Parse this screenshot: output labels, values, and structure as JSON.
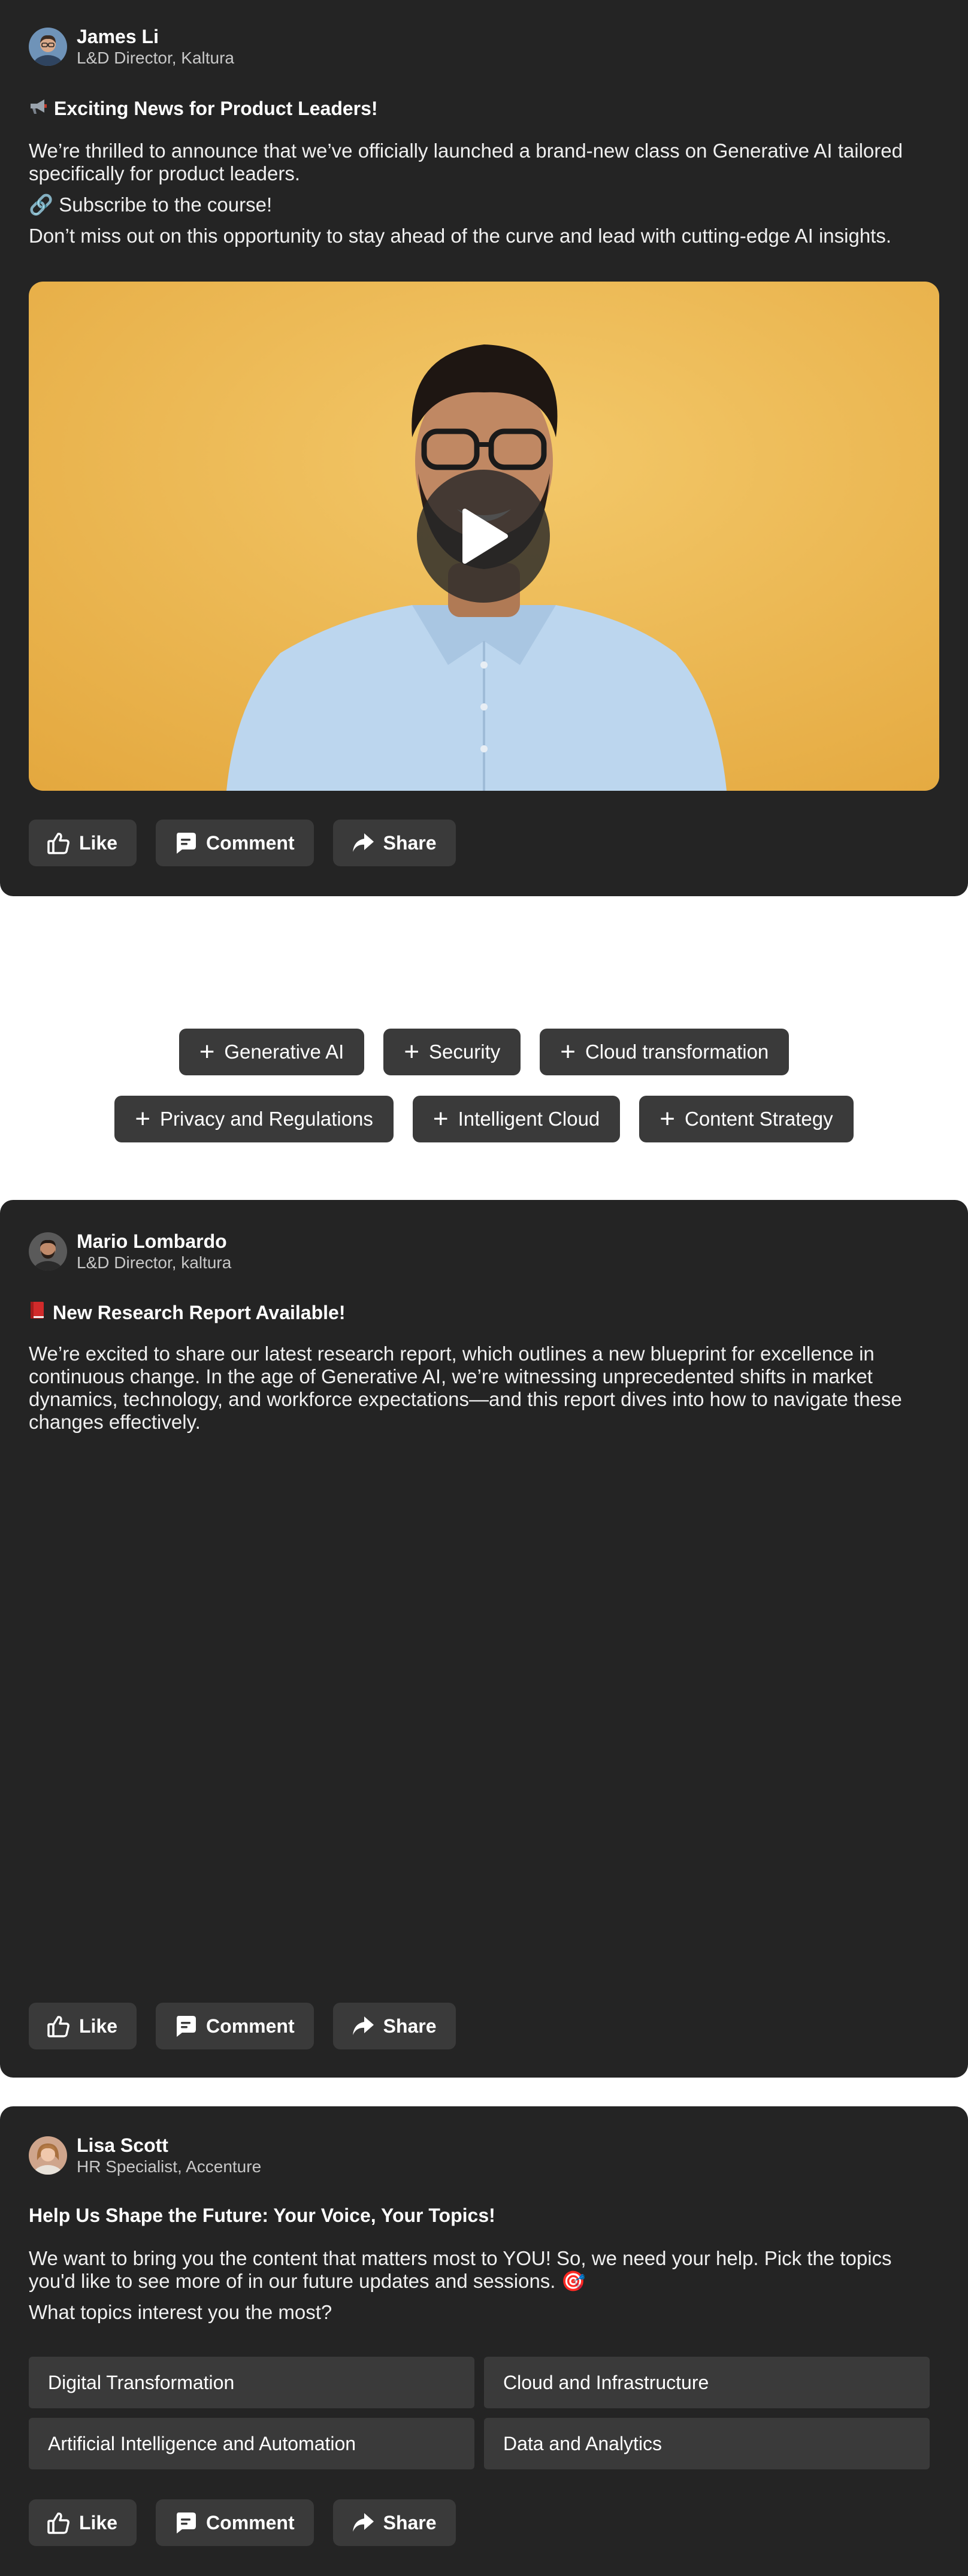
{
  "posts": [
    {
      "author": {
        "name": "James Li",
        "role": "L&D Director, Kaltura",
        "avatar": "avatar-man-glasses"
      },
      "headline": "Exciting News for Product Leaders!",
      "headline_icon": "megaphone-icon",
      "paragraphs": [
        "We’re thrilled to announce that we’ve officially launched a brand-new class on Generative AI tailored specifically for product leaders.",
        "🔗 Subscribe to the course!",
        "Don’t miss out on this opportunity to stay ahead of the curve and lead with cutting-edge AI insights."
      ],
      "media": {
        "type": "video",
        "icon": "play-icon"
      },
      "actions": {
        "like": "Like",
        "comment": "Comment",
        "share": "Share"
      }
    },
    {
      "author": {
        "name": "Mario Lombardo",
        "role": "L&D Director, kaltura",
        "avatar": "avatar-man-beard"
      },
      "headline": "New Research Report Available!",
      "headline_icon": "book-icon",
      "paragraphs": [
        "We’re excited to share our latest research report, which outlines a new blueprint for excellence in continuous change. In the age of Generative AI, we’re witnessing unprecedented shifts in market dynamics, technology, and workforce expectations—and this report dives into how to navigate these changes effectively."
      ],
      "actions": {
        "like": "Like",
        "comment": "Comment",
        "share": "Share"
      }
    },
    {
      "author": {
        "name": "Lisa Scott",
        "role": "HR Specialist, Accenture",
        "avatar": "avatar-woman"
      },
      "headline": "Help Us Shape the Future: Your Voice, Your Topics!",
      "paragraphs": [
        "We want to bring you the content that matters most to YOU! So, we need your help. Pick the topics you'd like to see more of in our future updates and sessions. 🎯",
        "What topics interest you the most?"
      ],
      "poll_options": [
        "Digital Transformation",
        "Cloud and Infrastructure",
        "Artificial Intelligence and Automation",
        "Data and Analytics"
      ],
      "actions": {
        "like": "Like",
        "comment": "Comment",
        "share": "Share"
      }
    }
  ],
  "topic_chips": {
    "row1": [
      "Generative AI",
      "Security",
      "Cloud transformation"
    ],
    "row2": [
      "Privacy and Regulations",
      "Intelligent Cloud",
      "Content Strategy"
    ],
    "icon": "plus-icon"
  },
  "colors": {
    "card_bg": "#242424",
    "button_bg": "#3a3a3a",
    "video_bg": "#e8b249"
  }
}
